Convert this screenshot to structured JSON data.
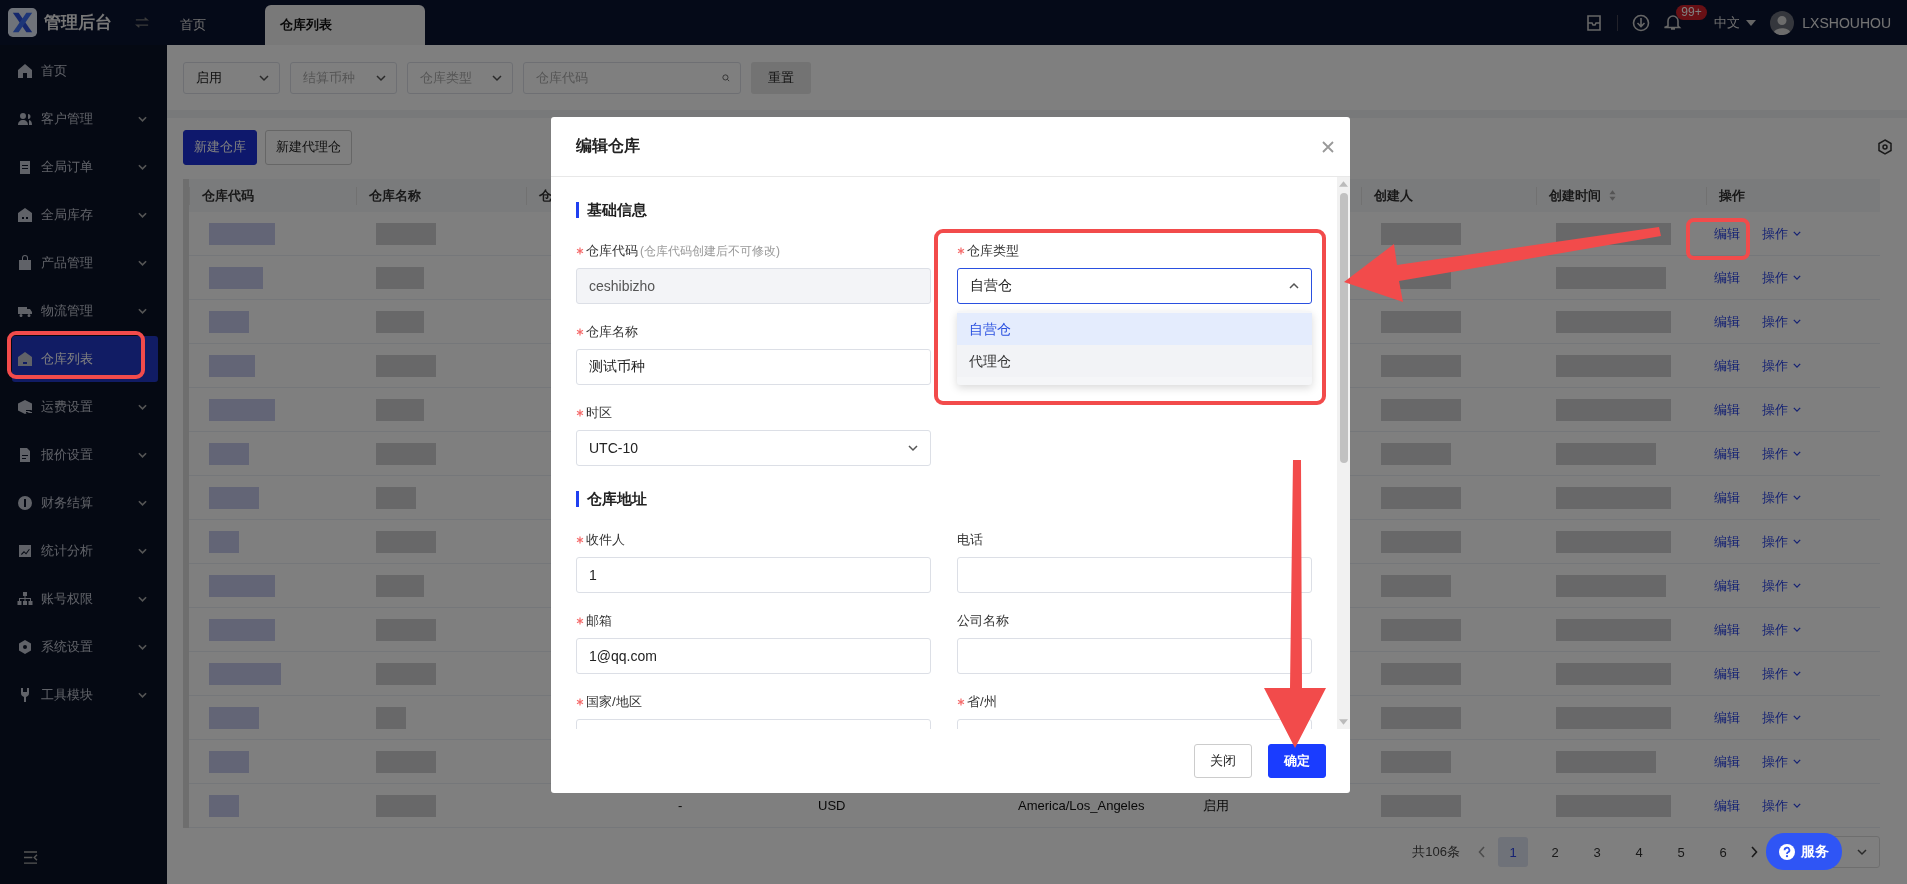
{
  "topbar": {
    "app_title": "管理后台",
    "tabs": [
      {
        "label": "首页",
        "selected": false
      },
      {
        "label": "仓库列表",
        "selected": true
      }
    ],
    "notification_badge": "99+",
    "language": "中文",
    "username": "LXSHOUHOU"
  },
  "sidebar": {
    "items": [
      {
        "label": "首页",
        "expandable": false,
        "selected": false
      },
      {
        "label": "客户管理",
        "expandable": true,
        "selected": false
      },
      {
        "label": "全局订单",
        "expandable": true,
        "selected": false
      },
      {
        "label": "全局库存",
        "expandable": true,
        "selected": false
      },
      {
        "label": "产品管理",
        "expandable": true,
        "selected": false
      },
      {
        "label": "物流管理",
        "expandable": true,
        "selected": false
      },
      {
        "label": "仓库列表",
        "expandable": false,
        "selected": true
      },
      {
        "label": "运费设置",
        "expandable": true,
        "selected": false
      },
      {
        "label": "报价设置",
        "expandable": true,
        "selected": false
      },
      {
        "label": "财务结算",
        "expandable": true,
        "selected": false
      },
      {
        "label": "统计分析",
        "expandable": true,
        "selected": false
      },
      {
        "label": "账号权限",
        "expandable": true,
        "selected": false
      },
      {
        "label": "系统设置",
        "expandable": true,
        "selected": false
      },
      {
        "label": "工具模块",
        "expandable": true,
        "selected": false
      }
    ]
  },
  "filters": [
    {
      "kind": "select",
      "value": "启用"
    },
    {
      "kind": "select",
      "placeholder": "结算币种"
    },
    {
      "kind": "select",
      "placeholder": "仓库类型"
    },
    {
      "kind": "search",
      "placeholder": "仓库代码"
    }
  ],
  "reset_button": "重置",
  "actions": [
    {
      "label": "新建仓库",
      "primary": true
    },
    {
      "label": "新建代理仓",
      "primary": false
    }
  ],
  "table": {
    "columns": [
      {
        "label": "仓库代码",
        "sortable": false
      },
      {
        "label": "仓库名称",
        "sortable": false
      },
      {
        "label": "仓",
        "sortable": false
      },
      {
        "label": "创建人",
        "sortable": false
      },
      {
        "label": "创建时间",
        "sortable": true
      },
      {
        "label": "操作",
        "sortable": false
      }
    ],
    "rows": [
      {
        "redacted": true,
        "edit": "编辑",
        "more": "操作"
      },
      {
        "redacted": true,
        "edit": "编辑",
        "more": "操作"
      },
      {
        "redacted": true,
        "edit": "编辑",
        "more": "操作"
      },
      {
        "redacted": true,
        "edit": "编辑",
        "more": "操作"
      },
      {
        "redacted": true,
        "edit": "编辑",
        "more": "操作"
      },
      {
        "redacted": true,
        "edit": "编辑",
        "more": "操作"
      },
      {
        "redacted": true,
        "edit": "编辑",
        "more": "操作"
      },
      {
        "redacted": true,
        "edit": "编辑",
        "more": "操作"
      },
      {
        "redacted": true,
        "edit": "编辑",
        "more": "操作"
      },
      {
        "redacted": true,
        "edit": "编辑",
        "more": "操作"
      },
      {
        "redacted": true,
        "edit": "编辑",
        "more": "操作"
      },
      {
        "redacted": true,
        "edit": "编辑",
        "more": "操作"
      },
      {
        "redacted": true,
        "edit": "编辑",
        "more": "操作"
      },
      {
        "redacted": true,
        "cells": [
          "-",
          "USD",
          "America/Los_Angeles",
          "启用"
        ],
        "edit": "编辑",
        "more": "操作"
      }
    ]
  },
  "pagination": {
    "total": "共106条",
    "pages": [
      {
        "label": "1",
        "selected": true
      },
      {
        "label": "2",
        "selected": false
      },
      {
        "label": "3",
        "selected": false
      },
      {
        "label": "4",
        "selected": false
      },
      {
        "label": "5",
        "selected": false
      },
      {
        "label": "6",
        "selected": false
      }
    ]
  },
  "dialog": {
    "title": "编辑仓库",
    "sections": [
      {
        "title": "基础信息",
        "rows": [
          [
            {
              "label": "仓库代码",
              "hint": "(仓库代码创建后不可修改)",
              "required": true,
              "kind": "input",
              "value": "ceshibizho",
              "disabled": true
            },
            {
              "label": "仓库类型",
              "required": true,
              "kind": "select",
              "value": "自营仓",
              "expanded": true,
              "options": [
                {
                  "label": "自营仓",
                  "selected": true,
                  "hovered": false
                },
                {
                  "label": "代理仓",
                  "selected": false,
                  "hovered": true
                }
              ]
            }
          ],
          [
            {
              "label": "仓库名称",
              "required": true,
              "kind": "input",
              "value": "测试币种",
              "disabled": false
            }
          ],
          [
            {
              "label": "时区",
              "required": true,
              "kind": "select",
              "value": "UTC-10",
              "expanded": false
            }
          ]
        ]
      },
      {
        "title": "仓库地址",
        "rows": [
          [
            {
              "label": "收件人",
              "required": true,
              "kind": "input",
              "value": "1",
              "disabled": false
            },
            {
              "label": "电话",
              "required": false,
              "kind": "input",
              "disabled": false
            }
          ],
          [
            {
              "label": "邮箱",
              "required": true,
              "kind": "input",
              "value": "1@qq.com",
              "disabled": false
            },
            {
              "label": "公司名称",
              "required": false,
              "kind": "input",
              "disabled": false
            }
          ],
          [
            {
              "label": "国家/地区",
              "required": true,
              "kind": "input",
              "disabled": false
            },
            {
              "label": "省/州",
              "required": true,
              "kind": "input",
              "disabled": false
            }
          ]
        ]
      }
    ],
    "buttons": [
      {
        "label": "关闭",
        "primary": false
      },
      {
        "label": "确定",
        "primary": true
      }
    ]
  },
  "service_button": "服务"
}
